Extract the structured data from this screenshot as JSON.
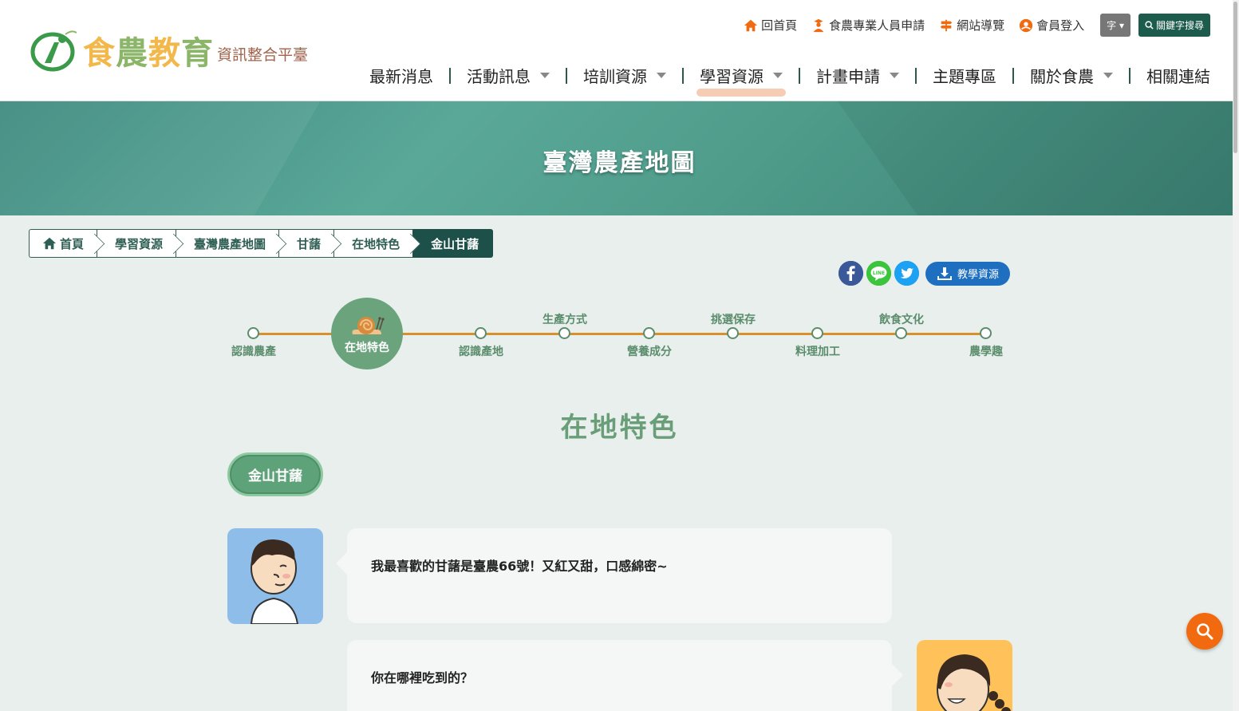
{
  "logo": {
    "main": "食農教育",
    "sub": "資訊整合平臺"
  },
  "topbar": {
    "home": "回首頁",
    "apply": "食農專業人員申請",
    "sitemap": "網站導覽",
    "login": "會員登入",
    "font": "字",
    "search": "關鍵字搜尋"
  },
  "nav": [
    {
      "label": "最新消息"
    },
    {
      "label": "活動訊息"
    },
    {
      "label": "培訓資源"
    },
    {
      "label": "學習資源"
    },
    {
      "label": "計畫申請"
    },
    {
      "label": "主題專區"
    },
    {
      "label": "關於食農"
    },
    {
      "label": "相關連結"
    }
  ],
  "banner": {
    "title": "臺灣農產地圖"
  },
  "breadcrumb": [
    {
      "label": "首頁"
    },
    {
      "label": "學習資源"
    },
    {
      "label": "臺灣農產地圖"
    },
    {
      "label": "甘藷"
    },
    {
      "label": "在地特色"
    },
    {
      "label": "金山甘藷"
    }
  ],
  "share": {
    "teach": "教學資源",
    "line": "LINE"
  },
  "timeline": {
    "active": "在地特色",
    "steps": [
      {
        "label": "認識農產"
      },
      {
        "label": "在地特色"
      },
      {
        "label": "認識產地"
      },
      {
        "label": "生產方式"
      },
      {
        "label": "營養成分"
      },
      {
        "label": "挑選保存"
      },
      {
        "label": "料理加工"
      },
      {
        "label": "飲食文化"
      },
      {
        "label": "農學趣"
      }
    ]
  },
  "section": {
    "title": "在地特色",
    "tag": "金山甘藷"
  },
  "dialog": [
    {
      "text": "我最喜歡的甘藷是臺農66號！又紅又甜，口感綿密~"
    },
    {
      "text": "你在哪裡吃到的？"
    }
  ],
  "colors": {
    "primary": "#1d5048",
    "accent": "#d7902c",
    "green": "#6aa37c",
    "orange": "#f26a0f"
  }
}
